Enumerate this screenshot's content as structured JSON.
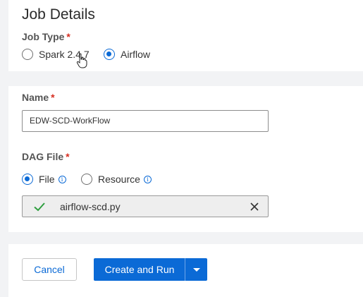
{
  "job_details": {
    "title": "Job Details",
    "job_type_label": "Job Type",
    "required_marker": "*",
    "job_type_options": [
      {
        "label": "Spark 2.4.7",
        "checked": false
      },
      {
        "label": "Airflow",
        "checked": true
      }
    ]
  },
  "name_section": {
    "name_label": "Name",
    "name_value": "EDW-SCD-WorkFlow",
    "dag_label": "DAG File",
    "dag_options": [
      {
        "label": "File",
        "checked": true,
        "icon": "info-icon"
      },
      {
        "label": "Resource",
        "checked": false,
        "icon": "info-icon"
      }
    ],
    "uploaded_file": "airflow-scd.py",
    "upload_status_icon": "checkmark-icon",
    "remove_icon": "close-icon"
  },
  "actions": {
    "cancel_label": "Cancel",
    "primary_label": "Create and Run",
    "dropdown_icon": "caret-down-icon"
  },
  "colors": {
    "accent": "#0b6ad6",
    "success": "#2e9e3f",
    "required": "#d62d20"
  }
}
